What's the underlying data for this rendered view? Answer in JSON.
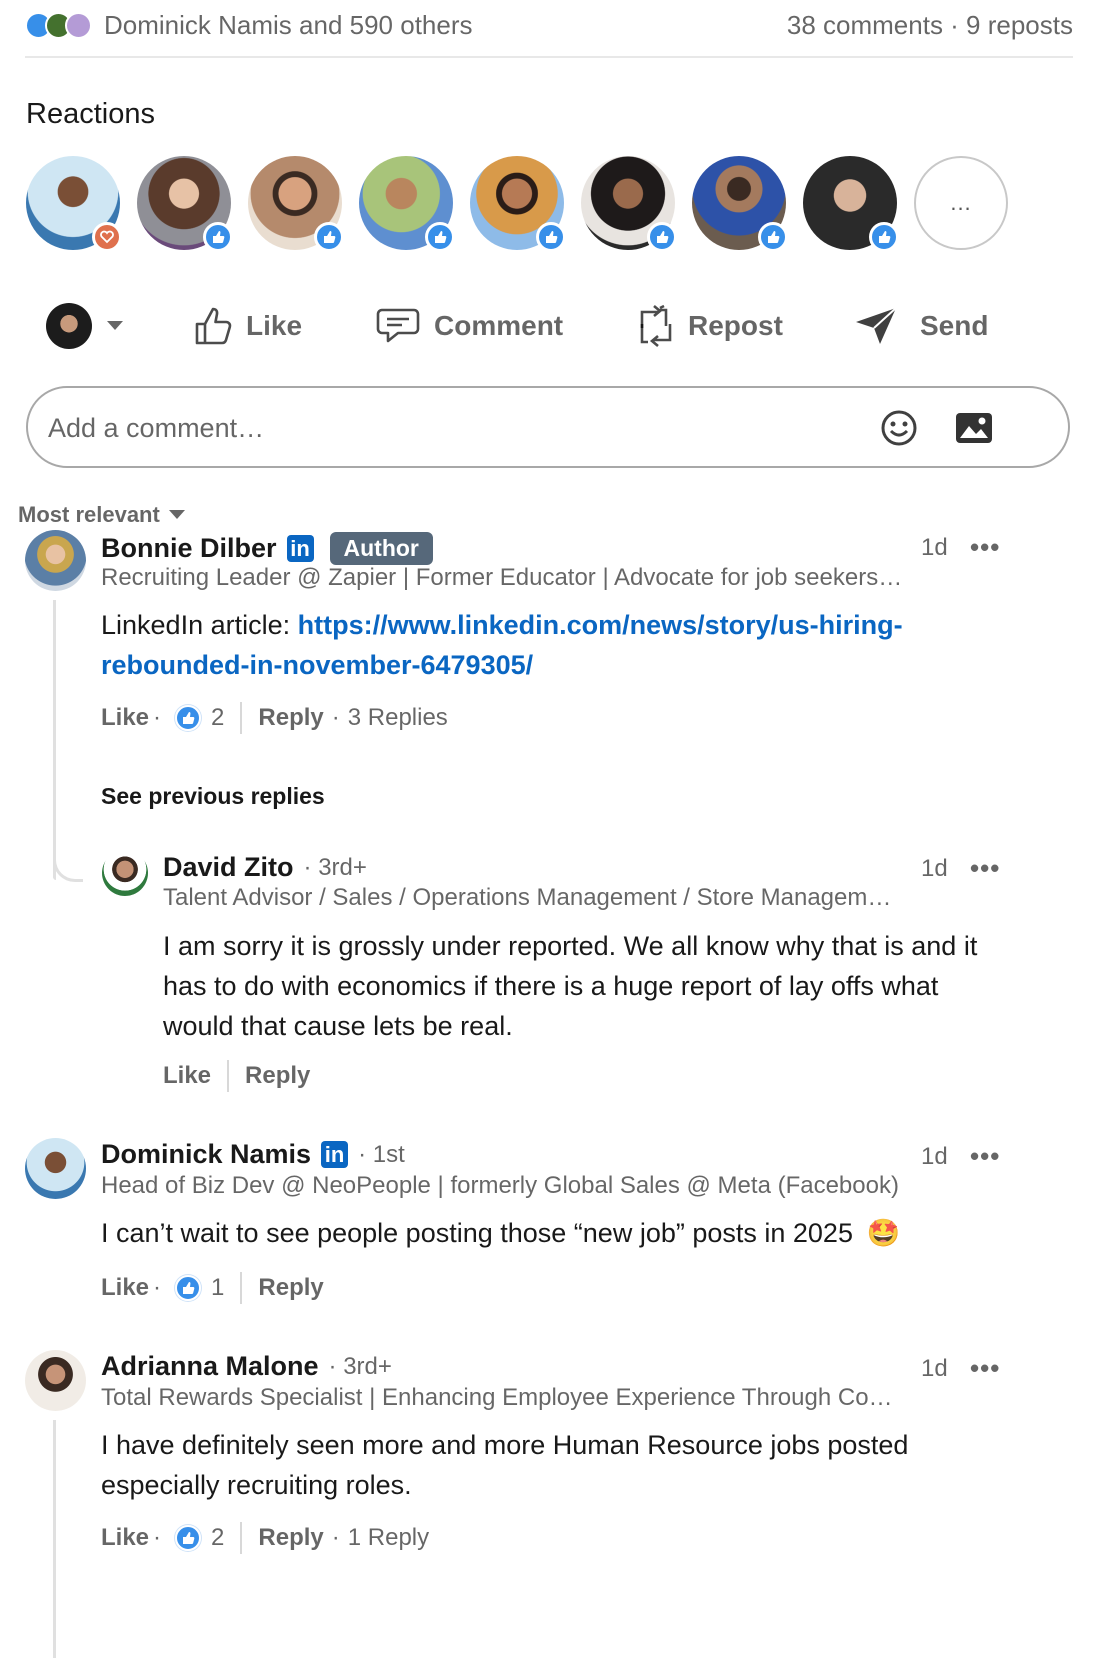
{
  "summary": {
    "reactors_text": "Dominick Namis and 590 others",
    "stats_text": "38 comments · 9 reposts"
  },
  "reactions_section": {
    "title": "Reactions",
    "more_label": "...",
    "avatars": [
      {
        "name": "reactor-1",
        "reaction": "love"
      },
      {
        "name": "reactor-2",
        "reaction": "like"
      },
      {
        "name": "reactor-3",
        "reaction": "like"
      },
      {
        "name": "reactor-4",
        "reaction": "like"
      },
      {
        "name": "reactor-5",
        "reaction": "like"
      },
      {
        "name": "reactor-6",
        "reaction": "like"
      },
      {
        "name": "reactor-7",
        "reaction": "like"
      },
      {
        "name": "reactor-8",
        "reaction": "like"
      }
    ]
  },
  "action_bar": {
    "like": "Like",
    "comment": "Comment",
    "repost": "Repost",
    "send": "Send"
  },
  "comment_input": {
    "placeholder": "Add a comment…"
  },
  "sort": {
    "label": "Most relevant"
  },
  "comments": [
    {
      "name": "Bonnie Dilber",
      "tag": "Author",
      "subtitle": "Recruiting Leader @ Zapier | Former Educator | Advocate for job seekers…",
      "time": "1d",
      "more": "•••",
      "body_prefix": "LinkedIn article: ",
      "link_line1": "https://www.linkedin.com/news/story/us-hiring-",
      "link_line2": "rebounded-in-november-6479305/",
      "like": "Like",
      "like_count": "2",
      "reply": "Reply",
      "replies": "3 Replies",
      "see_previous": "See previous replies"
    },
    {
      "name": "David Zito",
      "degree": "3rd+",
      "subtitle": "Talent Advisor / Sales / Operations Management / Store Managem…",
      "time": "1d",
      "more": "•••",
      "body_line1": "I am sorry it is grossly under reported. We all know why that is and it",
      "body_line2": "has to do with economics if there is a huge report of lay offs what",
      "body_line3": "would that cause lets be real.",
      "like": "Like",
      "reply": "Reply"
    },
    {
      "name": "Dominick Namis",
      "degree": "1st",
      "subtitle": "Head of Biz Dev @ NeoPeople | formerly Global Sales @ Meta (Facebook)",
      "time": "1d",
      "more": "•••",
      "body": "I can’t wait to see people posting those “new job” posts in 2025",
      "emoji": "🤩",
      "like": "Like",
      "like_count": "1",
      "reply": "Reply"
    },
    {
      "name": "Adrianna Malone",
      "degree": "3rd+",
      "subtitle": "Total Rewards Specialist | Enhancing Employee Experience Through Co…",
      "time": "1d",
      "more": "•••",
      "body_line1": "I have definitely seen more and more Human Resource jobs posted",
      "body_line2": "especially recruiting roles.",
      "like": "Like",
      "like_count": "2",
      "reply": "Reply",
      "replies": "1 Reply"
    }
  ],
  "colors": {
    "link": "#0a66c2",
    "like_blue": "#378fe9",
    "love_red": "#df704d",
    "author_tag_bg": "#56687a"
  }
}
